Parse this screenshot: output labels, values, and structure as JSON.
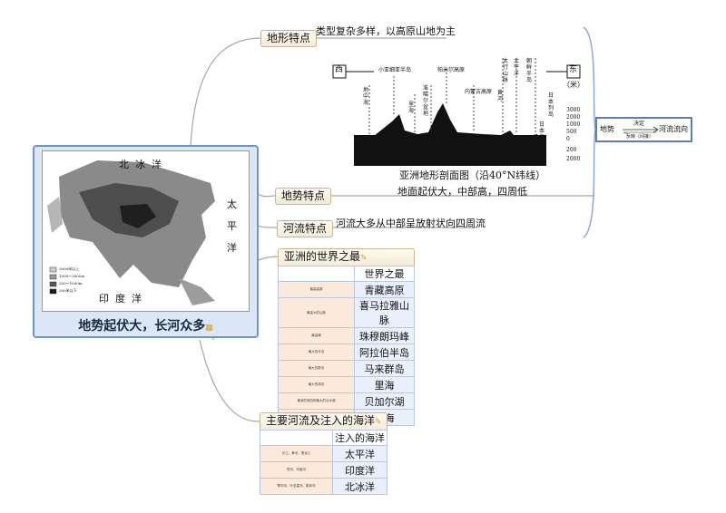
{
  "center": {
    "title": "地势起伏大，长河众多"
  },
  "map": {
    "labels": [
      "北",
      "冰",
      "洋",
      "太",
      "平",
      "洋",
      "印",
      "度",
      "洋"
    ],
    "legend": [
      "3000米以上",
      "1000～3000m",
      "200～1000m",
      "200米以下"
    ]
  },
  "branches": {
    "terrain_features": {
      "label": "地形特点",
      "note": "类型复杂多样，以高原山地为主"
    },
    "relief": {
      "label": "地势特点",
      "caption": "亚洲地形剖面图（沿40°N纬线）",
      "note": "地面起伏大，中部高，四周低"
    },
    "rivers": {
      "label": "河流特点",
      "note": "河流大多从中部呈放射状向四周流"
    }
  },
  "profile": {
    "west": "西",
    "east": "东",
    "unit": "（米）",
    "axis_ticks": [
      "3000",
      "2000",
      "1000",
      "500",
      "0",
      "200",
      "2000"
    ],
    "places": [
      "地中海",
      "小亚细亚半岛",
      "里海",
      "帕米尔高原",
      "内蒙古高原",
      "准噶尔盆地",
      "黄河",
      "太行山脉",
      "太平洋",
      "日本列岛",
      "日本海",
      "朝鲜半岛"
    ]
  },
  "relation": {
    "left": "地势",
    "top": "决定",
    "right": "河流流向",
    "bottom": "反映（间接）"
  },
  "world_records": {
    "title": "亚洲的世界之最",
    "header": "世界之最",
    "rows": [
      {
        "item": "最高高原",
        "value": "青藏高原"
      },
      {
        "item": "最高大的山脉",
        "value": "喜马拉雅山脉"
      },
      {
        "item": "最高峰",
        "value": "珠穆朗玛峰"
      },
      {
        "item": "最大的半岛",
        "value": "阿拉伯半岛"
      },
      {
        "item": "最大的群岛",
        "value": "马来群岛"
      },
      {
        "item": "最大的湖泊",
        "value": "里海"
      },
      {
        "item": "最深的湖泊和最大的淡水湖",
        "value": "贝加尔湖"
      },
      {
        "item": "陆地最低点（-415米）",
        "value": "死海"
      }
    ]
  },
  "rivers_table": {
    "title": "主要河流及注入的海洋",
    "header": "注入的海洋",
    "rows": [
      {
        "rivers": "长江、黄河、黑龙江",
        "ocean": "太平洋"
      },
      {
        "rivers": "恒河、印度河",
        "ocean": "印度洋"
      },
      {
        "rivers": "鄂毕河、叶尼塞河、勒拿河",
        "ocean": "北冰洋"
      }
    ]
  }
}
